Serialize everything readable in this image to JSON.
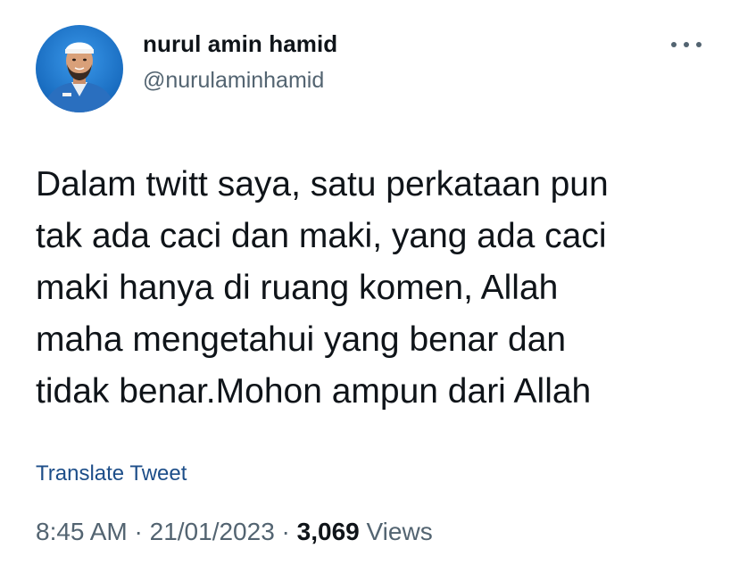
{
  "colors": {
    "text": "#0f1419",
    "secondary": "#536471",
    "link": "#1d4e89",
    "avatar_bg": "#1e7fd6"
  },
  "author": {
    "display_name": "nurul amin hamid",
    "handle": "@nurulaminhamid",
    "avatar_icon": "profile-photo"
  },
  "more_icon": "more-options-icon",
  "tweet": {
    "lines": [
      "Dalam twitt saya, satu perkataan pun",
      "tak ada caci dan maki, yang ada caci",
      "maki hanya di ruang komen, Allah",
      "maha mengetahui yang benar dan",
      "tidak benar.Mohon ampun dari Allah"
    ],
    "translate_label": "Translate Tweet"
  },
  "meta": {
    "time": "8:45 AM",
    "separator": "·",
    "date": "21/01/2023",
    "views_count": "3,069",
    "views_label": "Views"
  }
}
